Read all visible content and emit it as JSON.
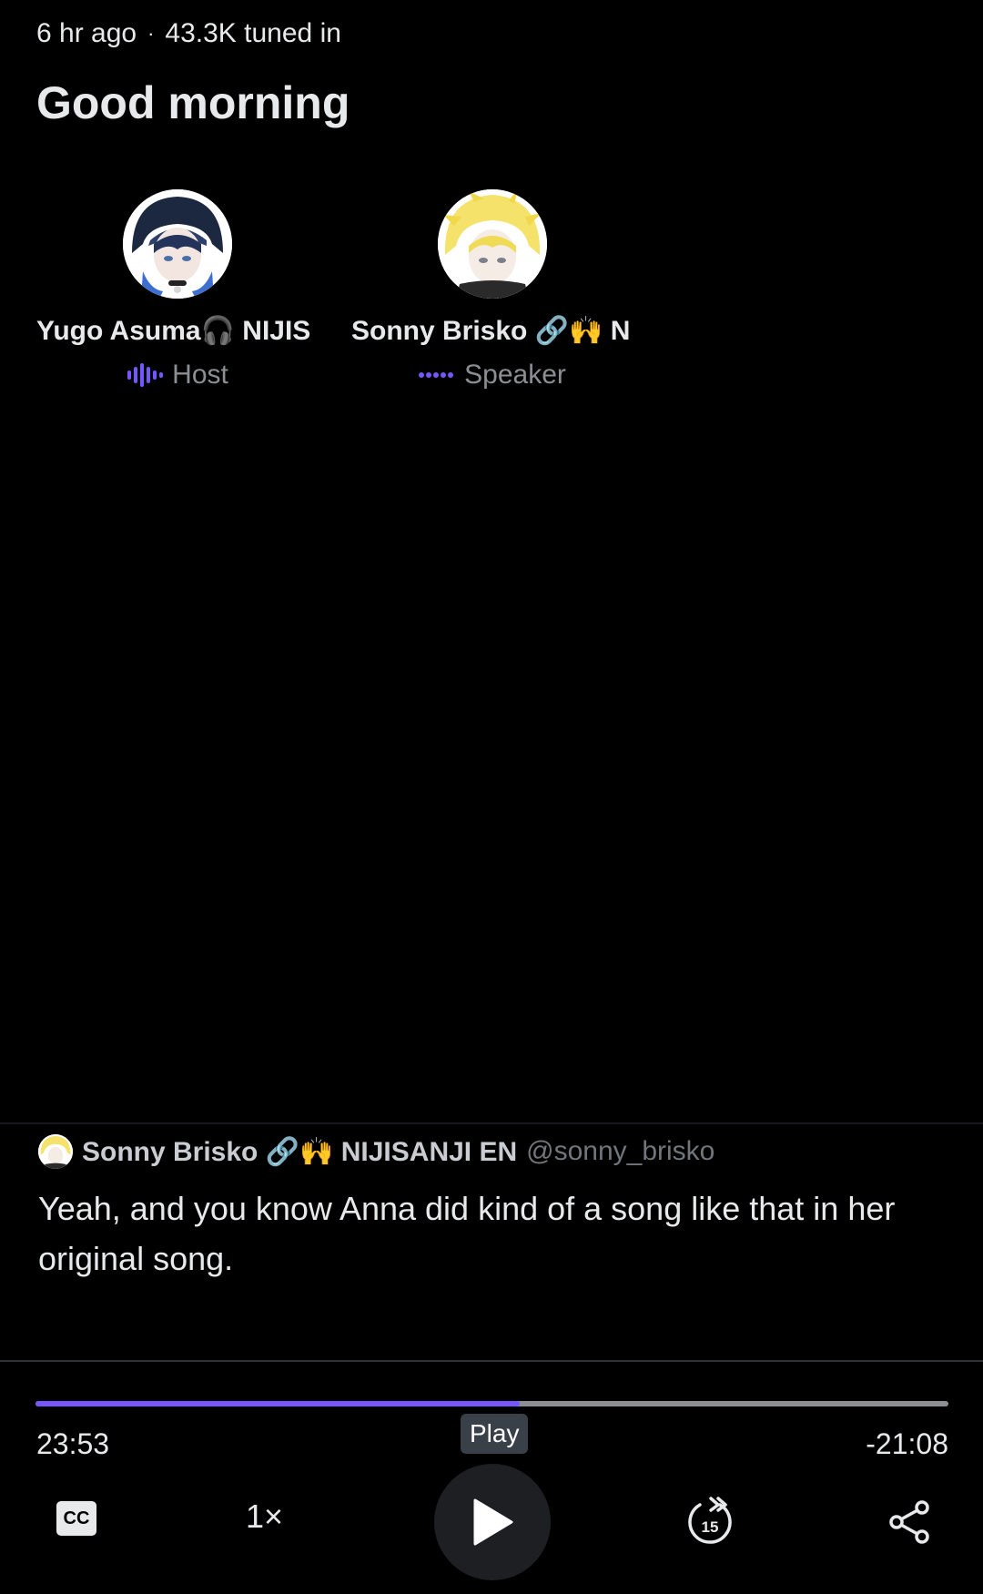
{
  "space": {
    "time_ago": "6 hr ago",
    "separator": "·",
    "listeners": "43.3K tuned in",
    "title": "Good morning"
  },
  "speakers": [
    {
      "name": "Yugo Asuma🎧 NIJIS",
      "role": "Host"
    },
    {
      "name": "Sonny Brisko 🔗🙌 N",
      "role": "Speaker"
    }
  ],
  "caption": {
    "name": "Sonny Brisko 🔗🙌 NIJISANJI EN",
    "handle": "@sonny_brisko",
    "text": "Yeah, and you know Anna did kind of a song like that in her original song."
  },
  "player": {
    "elapsed": "23:53",
    "remaining": "-21:08",
    "progress_percent": 53,
    "tooltip": "Play",
    "cc_label": "CC",
    "speed_label": "1×",
    "skip_label": "15",
    "accent_color": "#7856ff"
  }
}
